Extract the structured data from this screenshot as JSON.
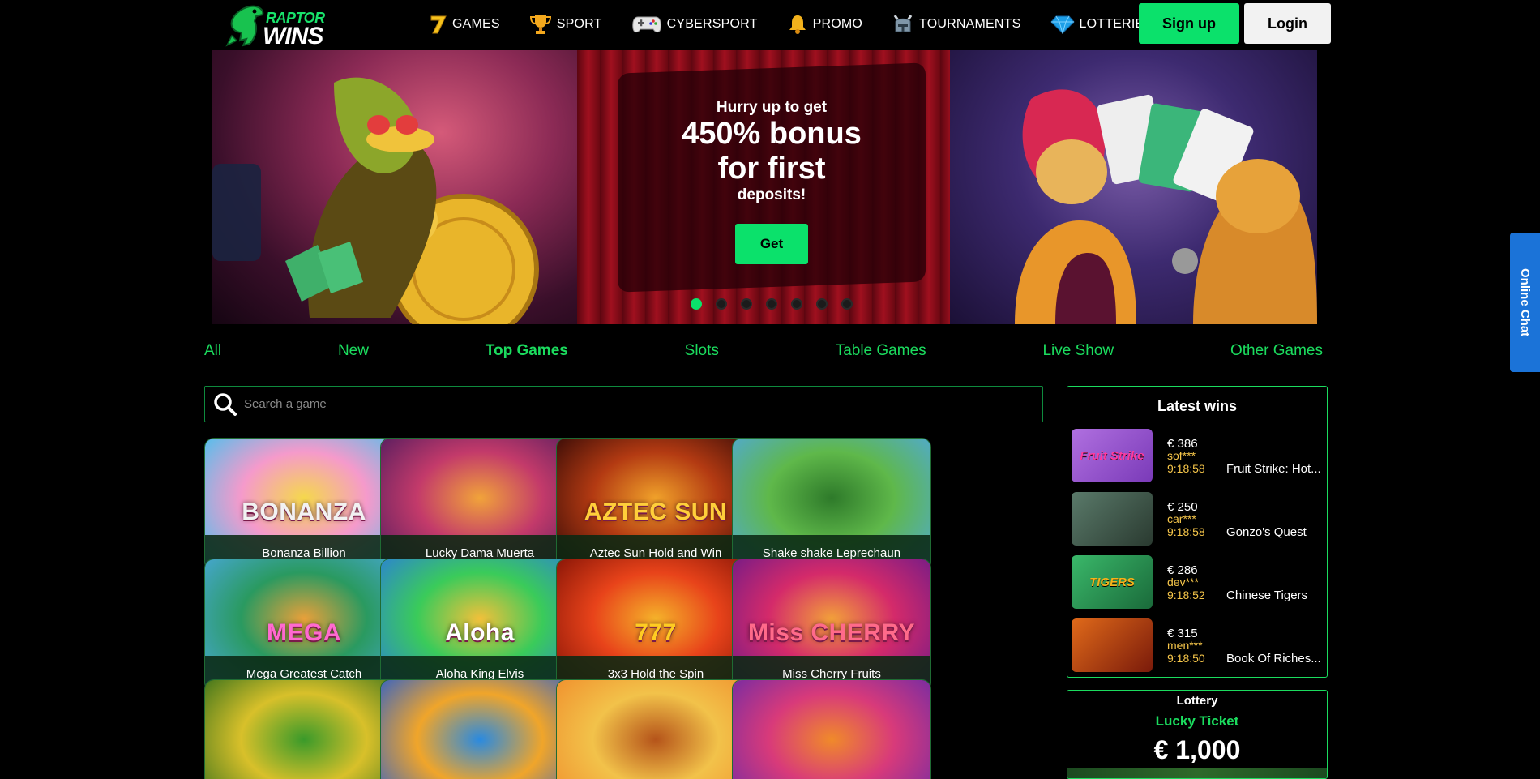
{
  "brand": {
    "line1": "RAPTOR",
    "line2": "WINS"
  },
  "nav": [
    {
      "label": "GAMES",
      "icon": "seven-icon"
    },
    {
      "label": "SPORT",
      "icon": "trophy-icon"
    },
    {
      "label": "CYBERSPORT",
      "icon": "gamepad-icon"
    },
    {
      "label": "PROMO",
      "icon": "bell-icon"
    },
    {
      "label": "TOURNAMENTS",
      "icon": "helmet-icon"
    },
    {
      "label": "LOTTERIES",
      "icon": "diamond-icon"
    }
  ],
  "auth": {
    "signup": "Sign up",
    "login": "Login"
  },
  "banner": {
    "small_top": "Hurry up to get",
    "big_line1": "450% bonus",
    "big_line2": "for first",
    "small_bottom": "deposits!",
    "cta": "Get",
    "slides": 7,
    "active_slide": 1
  },
  "tabs": [
    "All",
    "New",
    "Top Games",
    "Slots",
    "Table Games",
    "Live Show",
    "Other Games"
  ],
  "active_tab": "Top Games",
  "search": {
    "placeholder": "Search a game"
  },
  "games": [
    {
      "name": "Bonanza Billion",
      "art": "BONANZA"
    },
    {
      "name": "Lucky Dama Muerta",
      "art": ""
    },
    {
      "name": "Aztec Sun Hold and Win",
      "art": "AZTEC SUN"
    },
    {
      "name": "Shake shake Leprechaun",
      "art": ""
    },
    {
      "name": "Mega Greatest Catch",
      "art": "MEGA"
    },
    {
      "name": "Aloha King Elvis",
      "art": "Aloha"
    },
    {
      "name": "3x3 Hold the Spin",
      "art": "777"
    },
    {
      "name": "Miss Cherry Fruits",
      "art": "Miss CHERRY"
    },
    {
      "name": "",
      "art": ""
    },
    {
      "name": "",
      "art": ""
    },
    {
      "name": "",
      "art": ""
    },
    {
      "name": "",
      "art": ""
    }
  ],
  "latest_wins": {
    "title": "Latest wins",
    "items": [
      {
        "amount": "€ 386",
        "user": "sof***",
        "time": "9:18:58",
        "game": "Fruit Strike: Hot...",
        "thumb": "Fruit Strike"
      },
      {
        "amount": "€ 250",
        "user": "car***",
        "time": "9:18:58",
        "game": "Gonzo's Quest",
        "thumb": ""
      },
      {
        "amount": "€ 286",
        "user": "dev***",
        "time": "9:18:52",
        "game": "Chinese Tigers",
        "thumb": "TIGERS"
      },
      {
        "amount": "€ 315",
        "user": "men***",
        "time": "9:18:50",
        "game": "Book Of Riches...",
        "thumb": ""
      }
    ]
  },
  "lottery": {
    "title": "Lottery",
    "name": "Lucky Ticket",
    "amount": "€ 1,000"
  },
  "chat": {
    "label": "Online Chat"
  },
  "colors": {
    "accent": "#0be16b",
    "tab_green": "#1bdc5e",
    "win_user": "#f6c64a",
    "chat": "#1b73d8"
  }
}
